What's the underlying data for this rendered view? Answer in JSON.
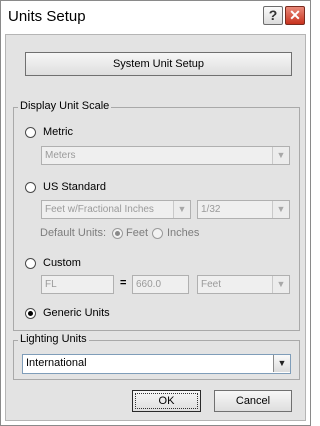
{
  "window": {
    "title": "Units Setup",
    "help_glyph": "?",
    "close_glyph": "✕"
  },
  "system_button": "System Unit Setup",
  "display": {
    "group_label": "Display Unit Scale",
    "metric_label": "Metric",
    "metric_select": "Meters",
    "us_label": "US Standard",
    "us_select": "Feet w/Fractional Inches",
    "us_fraction_select": "1/32",
    "default_units_label": "Default Units:",
    "feet_label": "Feet",
    "inches_label": "Inches",
    "custom_label": "Custom",
    "custom_name": "FL",
    "equals": "=",
    "custom_value": "660.0",
    "custom_unit_select": "Feet",
    "generic_label": "Generic Units",
    "selected_option": "Generic Units"
  },
  "lighting": {
    "group_label": "Lighting Units",
    "select_value": "International"
  },
  "buttons": {
    "ok": "OK",
    "cancel": "Cancel"
  },
  "icons": {
    "dropdown": "chevron-down-icon",
    "help": "help-icon",
    "close": "close-icon"
  },
  "colors": {
    "close_button": "#c8321e",
    "dialog_background": "#e3e3e3"
  }
}
